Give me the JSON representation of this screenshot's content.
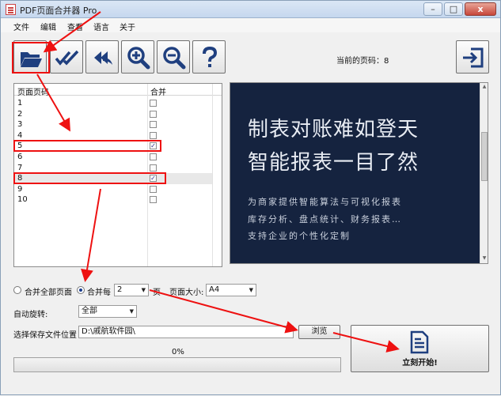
{
  "window": {
    "title": "PDF页面合并器 Pro",
    "min": "–",
    "max": "□",
    "close": "x"
  },
  "menu": [
    "文件",
    "编辑",
    "查看",
    "语言",
    "关于"
  ],
  "toolbar": {
    "open_icon": "folder-open-icon",
    "check_icon": "double-check-icon",
    "undo_icon": "double-back-arrow-icon",
    "zoom_in_icon": "zoom-in-icon",
    "zoom_out_icon": "zoom-out-icon",
    "help_icon": "question-mark-icon",
    "exit_icon": "exit-icon",
    "current_page": "当前的页码：8"
  },
  "list": {
    "headers": [
      "页面页码",
      "合并"
    ],
    "rows": [
      {
        "num": "1",
        "checked": false
      },
      {
        "num": "2",
        "checked": false
      },
      {
        "num": "3",
        "checked": false
      },
      {
        "num": "4",
        "checked": false
      },
      {
        "num": "5",
        "checked": true
      },
      {
        "num": "6",
        "checked": false
      },
      {
        "num": "7",
        "checked": false
      },
      {
        "num": "8",
        "checked": true
      },
      {
        "num": "9",
        "checked": false
      },
      {
        "num": "10",
        "checked": false
      }
    ]
  },
  "preview": {
    "line1": "制表对账难如登天",
    "line2": "智能报表一目了然",
    "sub1": "为商家提供智能算法与可视化报表",
    "sub2": "库存分析、盘点统计、财务报表…",
    "sub3": "支持企业的个性化定制"
  },
  "options": {
    "merge_all": "合并全部页面",
    "merge_every": "合并每",
    "every_value": "2",
    "page_unit": "页",
    "page_size_label": "页面大小:",
    "page_size_value": "A4",
    "rotate_label": "自动旋转:",
    "rotate_value": "全部",
    "save_label": "选择保存文件位置",
    "save_path": "D:\\戚航软件园\\",
    "browse": "浏览",
    "progress": "0%",
    "progress_value": 0,
    "start": "立刻开始!"
  },
  "colors": {
    "annotation": "#e11111",
    "preview_bg": "#15233f",
    "icon_blue": "#1f3f7f"
  }
}
